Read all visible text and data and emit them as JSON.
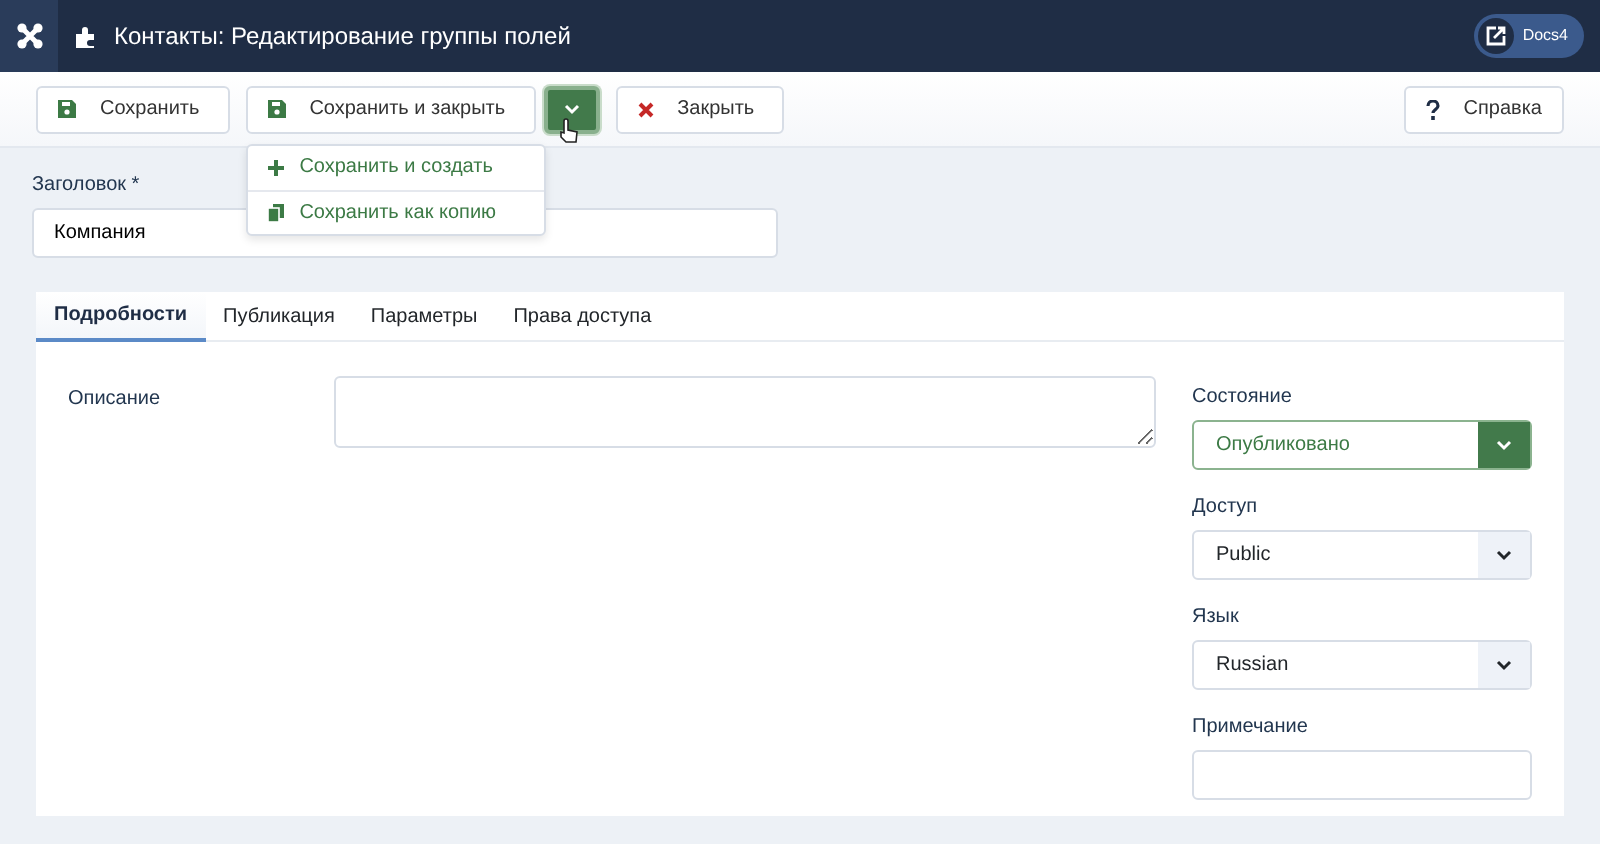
{
  "header": {
    "title": "Контакты: Редактирование группы полей",
    "link": "Docs4"
  },
  "toolbar": {
    "buttons": [
      {
        "kind": "save",
        "label": "Сохранить"
      },
      {
        "kind": "split",
        "label": "Сохранить и закрыть",
        "expanded": true,
        "menu": [
          {
            "kind": "plus",
            "label": "Сохранить и создать"
          },
          {
            "kind": "copy",
            "label": "Сохранить как копию"
          }
        ]
      },
      {
        "kind": "close",
        "label": "Закрыть"
      }
    ],
    "help": {
      "label": "Справка"
    }
  },
  "title_field": {
    "label": "Заголовок *",
    "value": "Компания"
  },
  "tabs": [
    {
      "label": "Подробности",
      "selected": true
    },
    {
      "label": "Публикация",
      "selected": false
    },
    {
      "label": "Параметры",
      "selected": false
    },
    {
      "label": "Права доступа",
      "selected": false
    }
  ],
  "description": {
    "label": "Описание"
  },
  "side_fields": [
    {
      "kind": "status",
      "label": "Состояние",
      "value": "Опубликовано"
    },
    {
      "kind": "select",
      "label": "Доступ",
      "value": "Public"
    },
    {
      "kind": "select",
      "label": "Язык",
      "value": "Russian"
    },
    {
      "kind": "text",
      "label": "Примечание"
    }
  ]
}
